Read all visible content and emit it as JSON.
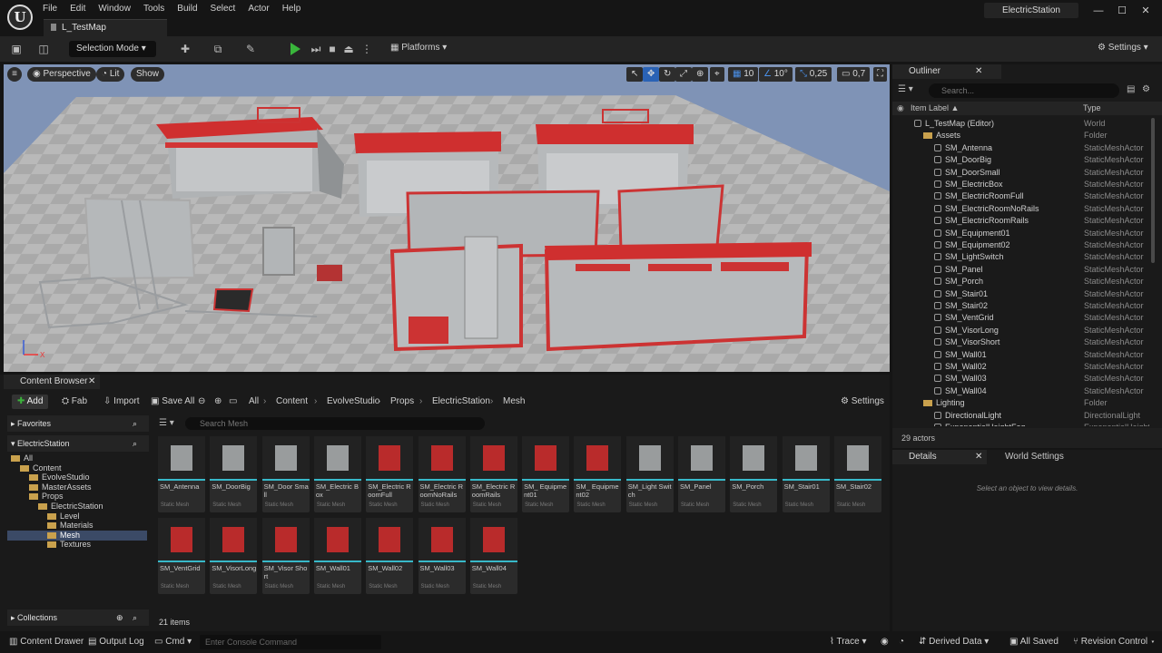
{
  "app": {
    "menu": [
      "File",
      "Edit",
      "Window",
      "Tools",
      "Build",
      "Select",
      "Actor",
      "Help"
    ],
    "map_tab": "L_TestMap",
    "project_name": "ElectricStation"
  },
  "toolbar": {
    "selection_mode": "Selection Mode",
    "platforms": "Platforms",
    "settings": "Settings"
  },
  "viewport": {
    "perspective": "Perspective",
    "lit": "Lit",
    "show": "Show",
    "grid_snap": "10",
    "rot_snap": "10°",
    "scale_snap": "0,25",
    "cam_speed": "0,7",
    "sky_color": "#7f93b6",
    "floor_color": "#b7b7b7",
    "accent": "#d32d2d"
  },
  "outliner": {
    "tab": "Outliner",
    "search_placeholder": "Search...",
    "col_label": "Item Label ▲",
    "col_type": "Type",
    "rows": [
      {
        "label": "L_TestMap (Editor)",
        "type": "World"
      },
      {
        "label": "Assets",
        "type": "Folder"
      },
      {
        "label": "SM_Antenna",
        "type": "StaticMeshActor"
      },
      {
        "label": "SM_DoorBig",
        "type": "StaticMeshActor"
      },
      {
        "label": "SM_DoorSmall",
        "type": "StaticMeshActor"
      },
      {
        "label": "SM_ElectricBox",
        "type": "StaticMeshActor"
      },
      {
        "label": "SM_ElectricRoomFull",
        "type": "StaticMeshActor"
      },
      {
        "label": "SM_ElectricRoomNoRails",
        "type": "StaticMeshActor"
      },
      {
        "label": "SM_ElectricRoomRails",
        "type": "StaticMeshActor"
      },
      {
        "label": "SM_Equipment01",
        "type": "StaticMeshActor"
      },
      {
        "label": "SM_Equipment02",
        "type": "StaticMeshActor"
      },
      {
        "label": "SM_LightSwitch",
        "type": "StaticMeshActor"
      },
      {
        "label": "SM_Panel",
        "type": "StaticMeshActor"
      },
      {
        "label": "SM_Porch",
        "type": "StaticMeshActor"
      },
      {
        "label": "SM_Stair01",
        "type": "StaticMeshActor"
      },
      {
        "label": "SM_Stair02",
        "type": "StaticMeshActor"
      },
      {
        "label": "SM_VentGrid",
        "type": "StaticMeshActor"
      },
      {
        "label": "SM_VisorLong",
        "type": "StaticMeshActor"
      },
      {
        "label": "SM_VisorShort",
        "type": "StaticMeshActor"
      },
      {
        "label": "SM_Wall01",
        "type": "StaticMeshActor"
      },
      {
        "label": "SM_Wall02",
        "type": "StaticMeshActor"
      },
      {
        "label": "SM_Wall03",
        "type": "StaticMeshActor"
      },
      {
        "label": "SM_Wall04",
        "type": "StaticMeshActor"
      },
      {
        "label": "Lighting",
        "type": "Folder"
      },
      {
        "label": "DirectionalLight",
        "type": "DirectionalLight"
      },
      {
        "label": "ExponentialHeightFog",
        "type": "ExponentialHeightFog"
      }
    ],
    "actor_count": "29 actors"
  },
  "details": {
    "tab_details": "Details",
    "tab_world": "World Settings",
    "empty_msg": "Select an object to view details."
  },
  "content_browser": {
    "tab": "Content Browser",
    "add": "Add",
    "fab": "Fab",
    "import": "Import",
    "save_all": "Save All",
    "breadcrumb": [
      "All",
      "Content",
      "EvolveStudio",
      "Props",
      "ElectricStation",
      "Mesh"
    ],
    "settings": "Settings",
    "favorites": "Favorites",
    "project": "ElectricStation",
    "search_placeholder": "Search Mesh",
    "tree": [
      "All",
      "Content",
      "EvolveStudio",
      "MasterAssets",
      "Props",
      "ElectricStation",
      "Level",
      "Materials",
      "Mesh",
      "Textures"
    ],
    "collections": "Collections",
    "item_count": "21 items",
    "asset_type": "Static Mesh",
    "assets": [
      "SM_Antenna",
      "SM_DoorBig",
      "SM_Door Small",
      "SM_Electric Box",
      "SM_Electric RoomFull",
      "SM_Electric RoomNoRails",
      "SM_Electric RoomRails",
      "SM_ Equipment01",
      "SM_ Equipment02",
      "SM_Light Switch",
      "SM_Panel",
      "SM_Porch",
      "SM_Stair01",
      "SM_Stair02",
      "SM_VentGrid",
      "SM_VisorLong",
      "SM_Visor Short",
      "SM_Wall01",
      "SM_Wall02",
      "SM_Wall03",
      "SM_Wall04"
    ]
  },
  "statusbar": {
    "content_drawer": "Content Drawer",
    "output_log": "Output Log",
    "cmd": "Cmd",
    "console_placeholder": "Enter Console Command",
    "trace": "Trace",
    "derived_data": "Derived Data",
    "all_saved": "All Saved",
    "revision_control": "Revision Control"
  }
}
